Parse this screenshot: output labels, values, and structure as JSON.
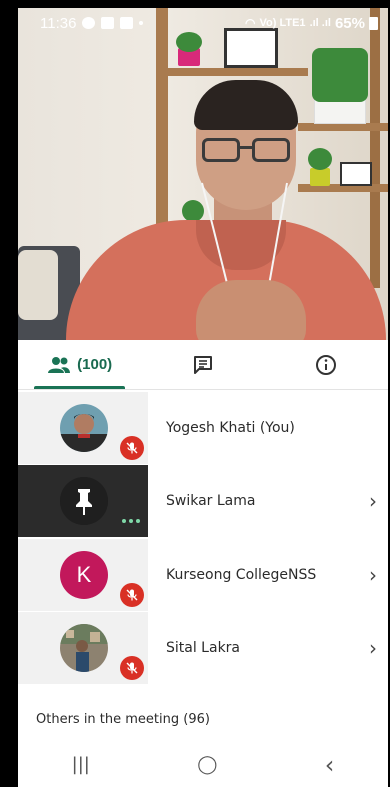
{
  "status_bar": {
    "time": "11:36",
    "network": "Vo) LTE1",
    "battery": "65%"
  },
  "tabs": [
    {
      "label": "(100)",
      "icon": "people-icon",
      "active": true
    },
    {
      "label": "",
      "icon": "chat-icon",
      "active": false
    },
    {
      "label": "",
      "icon": "info-icon",
      "active": false
    }
  ],
  "participants": [
    {
      "name": "Yogesh Khati (You)",
      "muted": true,
      "has_chevron": false
    },
    {
      "name": "Swikar Lama",
      "muted": false,
      "has_chevron": true
    },
    {
      "name": "Kurseong CollegeNSS",
      "initial": "K",
      "muted": true,
      "has_chevron": true
    },
    {
      "name": "Sital Lakra",
      "muted": true,
      "has_chevron": true
    }
  ],
  "others_label": "Others in the meeting (96)",
  "chevron_glyph": "›",
  "nav": {
    "recents": "|||",
    "home": "◯",
    "back": "‹"
  },
  "colors": {
    "accent": "#1a7355",
    "mute_red": "#d93025",
    "avatar_k": "#c2185b"
  }
}
